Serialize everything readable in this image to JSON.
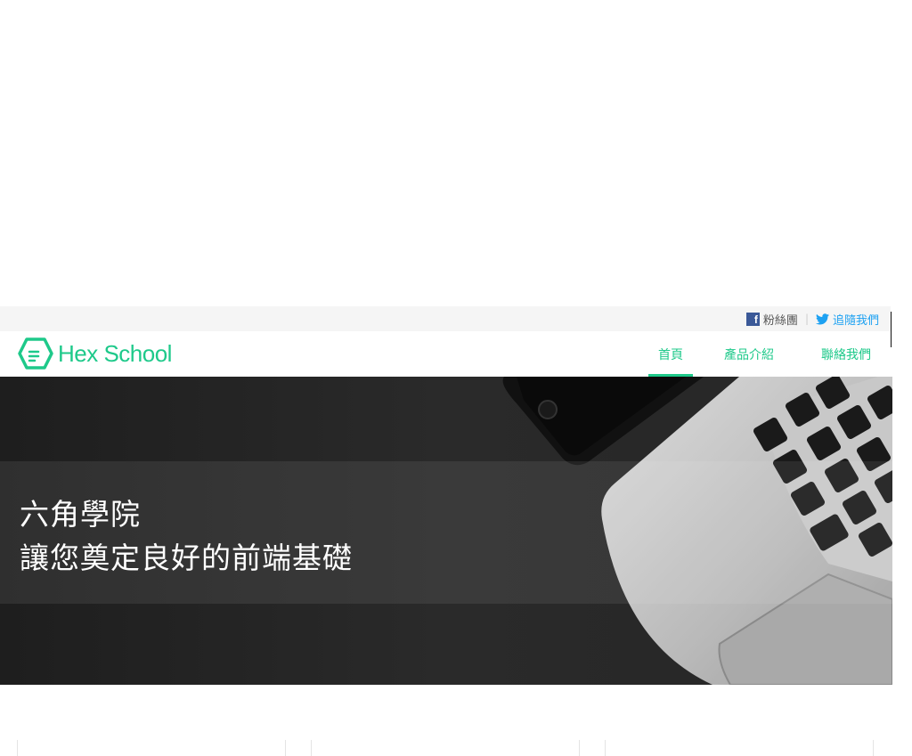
{
  "topbar": {
    "facebook_label": "粉絲團",
    "twitter_label": "追隨我們",
    "divider": "|"
  },
  "header": {
    "logo_text": "Hex School",
    "nav": [
      {
        "label": "首頁",
        "active": true
      },
      {
        "label": "產品介紹",
        "active": false
      },
      {
        "label": "聯絡我們",
        "active": false
      }
    ]
  },
  "hero": {
    "line1": "六角學院",
    "line2": "讓您奠定良好的前端基礎"
  },
  "colors": {
    "brand": "#1ec98a",
    "twitter": "#1da1f2",
    "facebook": "#3b5998",
    "hero_bg": "#232323"
  }
}
